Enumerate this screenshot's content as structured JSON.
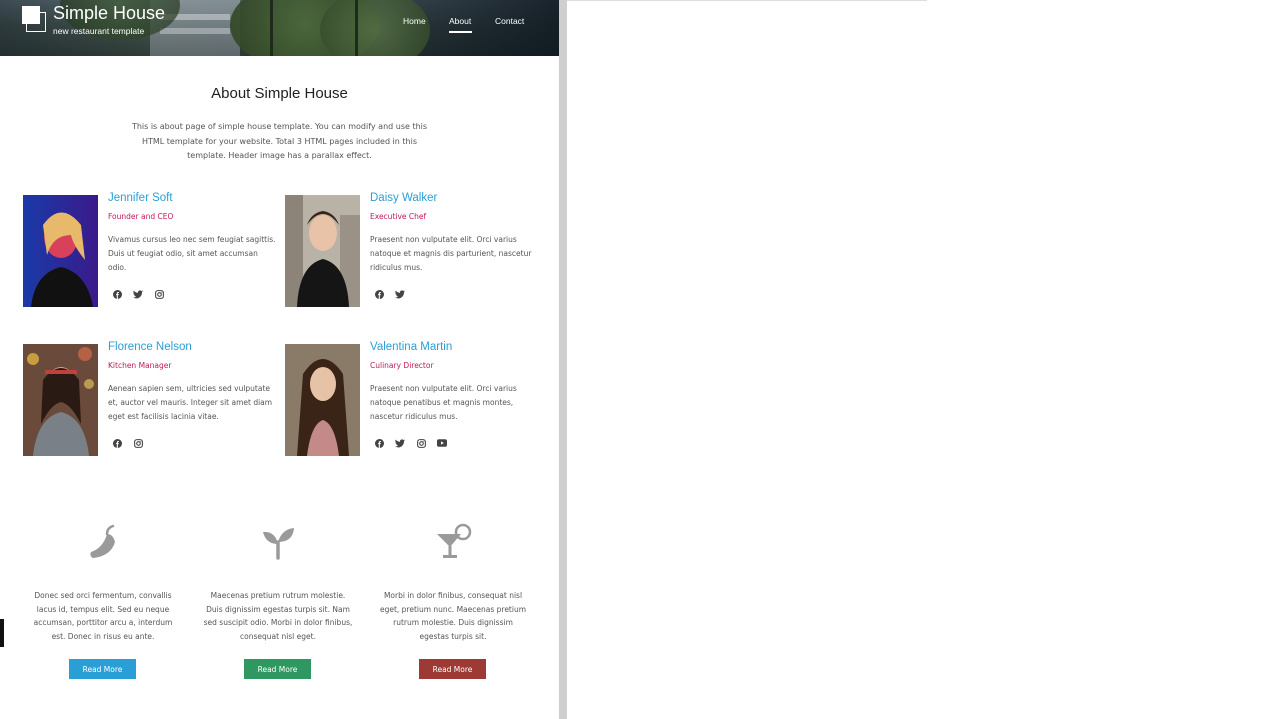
{
  "header": {
    "site_title": "Simple House",
    "site_tagline": "new restaurant template",
    "nav": [
      {
        "label": "Home",
        "active": false
      },
      {
        "label": "About",
        "active": true
      },
      {
        "label": "Contact",
        "active": false
      }
    ]
  },
  "about": {
    "title": "About Simple House",
    "description": "This is about page of simple house template. You can modify and use this HTML template for your website. Total 3 HTML pages included in this template. Header image has a parallax effect."
  },
  "team": [
    {
      "name": "Jennifer Soft",
      "role": "Founder and CEO",
      "bio": "Vivamus cursus leo nec sem feugiat sagittis. Duis ut feugiat odio, sit amet accumsan odio.",
      "social": [
        "facebook-icon",
        "twitter-icon",
        "instagram-icon"
      ]
    },
    {
      "name": "Daisy Walker",
      "role": "Executive Chef",
      "bio": "Praesent non vulputate elit. Orci varius natoque et magnis dis parturient, nascetur ridiculus mus.",
      "social": [
        "facebook-icon",
        "twitter-icon"
      ]
    },
    {
      "name": "Florence Nelson",
      "role": "Kitchen Manager",
      "bio": "Aenean sapien sem, ultricies sed vulputate et, auctor vel mauris. Integer sit amet diam eget est facilisis lacinia vitae.",
      "social": [
        "facebook-icon",
        "instagram-icon"
      ]
    },
    {
      "name": "Valentina Martin",
      "role": "Culinary Director",
      "bio": "Praesent non vulputate elit. Orci varius natoque penatibus et magnis montes, nascetur ridiculus mus.",
      "social": [
        "facebook-icon",
        "twitter-icon",
        "instagram-icon",
        "youtube-icon"
      ]
    }
  ],
  "features": [
    {
      "icon": "pepper-icon",
      "text": "Donec sed orci fermentum, convallis lacus id, tempus elit. Sed eu neque accumsan, porttitor arcu a, interdum est. Donec in risus eu ante.",
      "button_label": "Read More",
      "button_color": "#2a9fd6"
    },
    {
      "icon": "seedling-icon",
      "text": "Maecenas pretium rutrum molestie. Duis dignissim egestas turpis sit. Nam sed suscipit odio. Morbi in dolor finibus, consequat nisl eget.",
      "button_label": "Read More",
      "button_color": "#2e9860"
    },
    {
      "icon": "cocktail-icon",
      "text": "Morbi in dolor finibus, consequat nisl eget, pretium nunc. Maecenas pretium rutrum molestie. Duis dignissim egestas turpis sit.",
      "button_label": "Read More",
      "button_color": "#9e3a36"
    }
  ],
  "colors": {
    "name_accent": "#2a9fd6",
    "role_accent": "#c2185b",
    "icon_gray": "#999999"
  }
}
